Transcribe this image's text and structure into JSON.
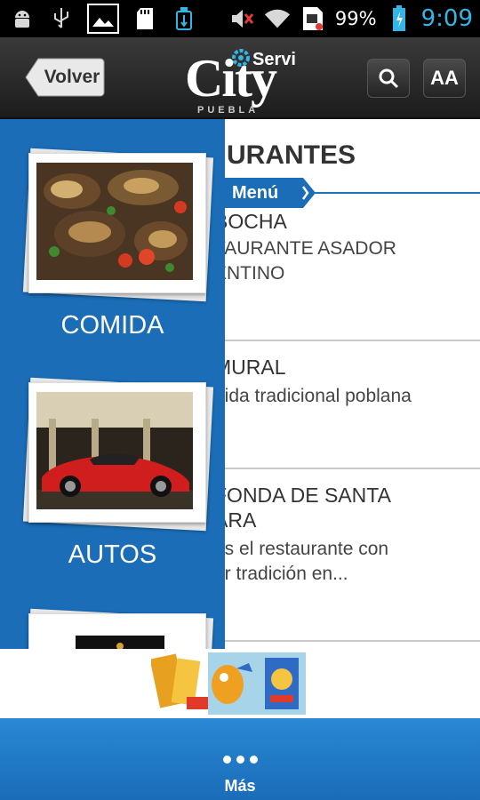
{
  "status_bar": {
    "left_icons": [
      "android-debug-icon",
      "usb-icon",
      "image-icon",
      "sd-card-icon",
      "usb-storage-icon"
    ],
    "right_icons": [
      "mute-icon",
      "wifi-icon",
      "sim-card-icon",
      "battery-icon"
    ],
    "battery_percent": "99%",
    "time": "9:09"
  },
  "header": {
    "back_label": "Volver",
    "logo": {
      "main": "City",
      "prefix": "Servi",
      "sub": "PUEBLA"
    },
    "search_icon": "search-icon",
    "font_size_label": "AA"
  },
  "main": {
    "title": "URANTES",
    "menu_tab": "Menú",
    "items": [
      {
        "name": "BOCHA",
        "desc_lines": [
          "TAURANTE ASADOR",
          "ENTINO"
        ]
      },
      {
        "name": "MURAL",
        "desc_lines": [
          "nida tradicional poblana"
        ]
      },
      {
        "name_lines": [
          "FONDA DE SANTA",
          "ARA"
        ],
        "desc_lines": [
          "os el restaurante con",
          "or tradición en..."
        ]
      }
    ]
  },
  "drawer": {
    "categories": [
      {
        "label": "COMIDA",
        "image": "food-platter-photo"
      },
      {
        "label": "AUTOS",
        "image": "red-sports-car-photo"
      },
      {
        "label": "",
        "image": "third-category-photo"
      }
    ]
  },
  "ad_banner": {
    "image": "candy-advertisement"
  },
  "bottom_bar": {
    "more_label": "Más"
  },
  "colors": {
    "drawer_blue": "#1a6db6",
    "accent_cyan": "#33b5e5",
    "header_dark": "#2a2a2a"
  }
}
